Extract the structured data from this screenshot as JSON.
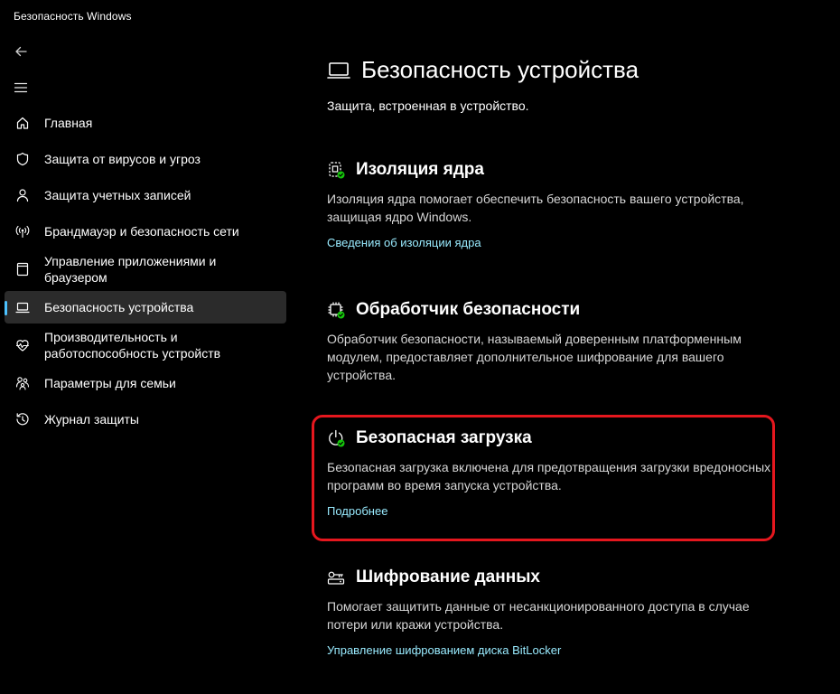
{
  "app": {
    "title": "Безопасность Windows"
  },
  "colors": {
    "accent": "#4cc2ff",
    "link": "#99ebff",
    "status_ok": "#16c60c",
    "highlight": "#e5171e"
  },
  "nav": {
    "back_icon": "back-arrow-icon",
    "menu_icon": "hamburger-menu-icon",
    "items": [
      {
        "label": "Главная",
        "icon": "home-icon"
      },
      {
        "label": "Защита от вирусов и угроз",
        "icon": "shield-icon"
      },
      {
        "label": "Защита учетных записей",
        "icon": "person-icon"
      },
      {
        "label": "Брандмауэр и безопасность сети",
        "icon": "wireless-antenna-icon"
      },
      {
        "label": "Управление приложениями и браузером",
        "icon": "app-browser-icon"
      },
      {
        "label": "Безопасность устройства",
        "icon": "laptop-icon",
        "selected": true
      },
      {
        "label": "Производительность и работоспособность устройств",
        "icon": "heart-pulse-icon"
      },
      {
        "label": "Параметры для семьи",
        "icon": "family-icon"
      },
      {
        "label": "Журнал защиты",
        "icon": "history-icon"
      }
    ]
  },
  "main": {
    "title": "Безопасность устройства",
    "subtitle": "Защита, встроенная в устройство.",
    "sections": [
      {
        "title": "Изоляция ядра",
        "description": "Изоляция ядра помогает обеспечить безопасность вашего устройства, защищая ядро Windows.",
        "link": "Сведения об изоляции ядра",
        "icon": "core-isolation-icon"
      },
      {
        "title": "Обработчик безопасности",
        "description": "Обработчик безопасности, называемый доверенным платформенным модулем, предоставляет дополнительное шифрование для вашего устройства.",
        "link": "",
        "icon": "chip-icon"
      },
      {
        "title": "Безопасная загрузка",
        "description": "Безопасная загрузка включена для предотвращения загрузки вредоносных программ во время запуска устройства.",
        "link": "Подробнее",
        "icon": "power-check-icon"
      },
      {
        "title": "Шифрование данных",
        "description": "Помогает защитить данные от несанкционированного доступа в случае потери или кражи устройства.",
        "link": "Управление шифрованием диска BitLocker",
        "icon": "key-drive-icon"
      }
    ]
  }
}
